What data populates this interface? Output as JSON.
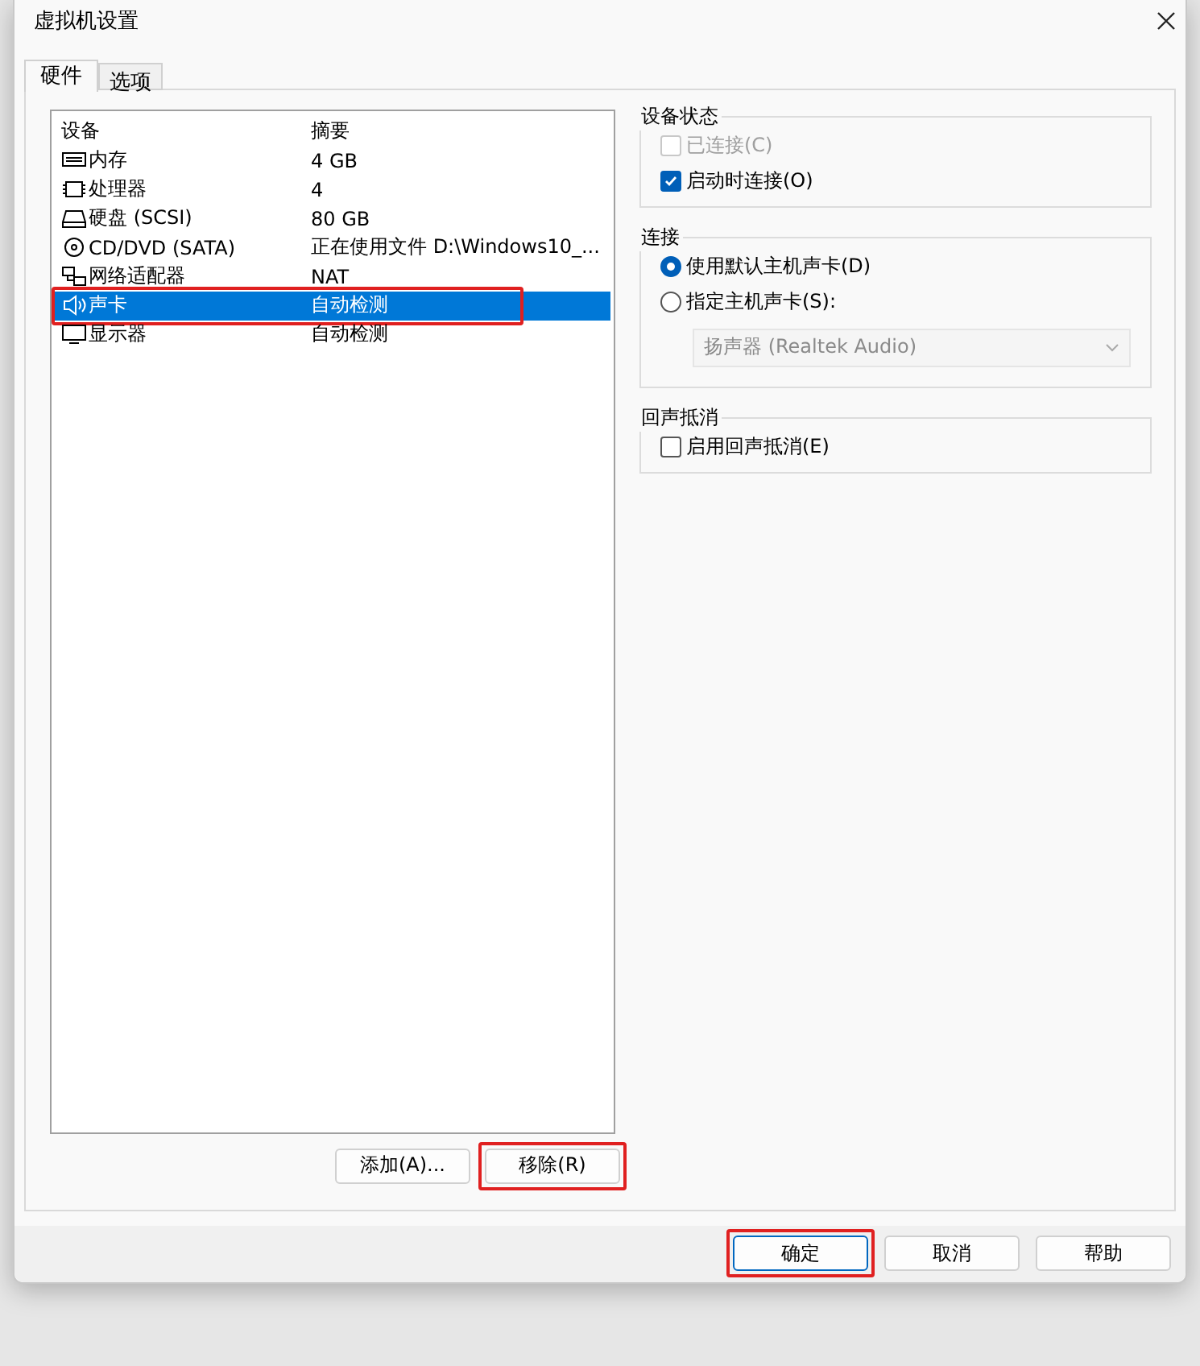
{
  "window": {
    "title": "虚拟机设置"
  },
  "tabs": [
    {
      "label": "硬件",
      "selected": true
    },
    {
      "label": "选项",
      "selected": false
    }
  ],
  "device_list": {
    "columns": [
      "设备",
      "摘要"
    ],
    "rows": [
      {
        "kind": "memory",
        "device": "内存",
        "summary": "4 GB",
        "selected": false,
        "highlighted": false
      },
      {
        "kind": "cpu",
        "device": "处理器",
        "summary": "4",
        "selected": false,
        "highlighted": false
      },
      {
        "kind": "disk",
        "device": "硬盘 (SCSI)",
        "summary": "80 GB",
        "selected": false,
        "highlighted": false
      },
      {
        "kind": "cdrom",
        "device": "CD/DVD (SATA)",
        "summary": "正在使用文件 D:\\Windows10_...",
        "selected": false,
        "highlighted": false
      },
      {
        "kind": "network",
        "device": "网络适配器",
        "summary": "NAT",
        "selected": false,
        "highlighted": false
      },
      {
        "kind": "sound",
        "device": "声卡",
        "summary": "自动检测",
        "selected": true,
        "highlighted": true
      },
      {
        "kind": "display",
        "device": "显示器",
        "summary": "自动检测",
        "selected": false,
        "highlighted": false
      }
    ]
  },
  "list_buttons": [
    {
      "label": "添加(A)...",
      "highlighted": false
    },
    {
      "label": "移除(R)",
      "highlighted": true
    }
  ],
  "groups": [
    {
      "title": "设备状态",
      "items": [
        {
          "kind": "checkbox",
          "label": "已连接(C)",
          "checked": false,
          "disabled": true
        },
        {
          "kind": "checkbox",
          "label": "启动时连接(O)",
          "checked": true,
          "disabled": false
        }
      ]
    },
    {
      "title": "连接",
      "items": [
        {
          "kind": "radio",
          "label": "使用默认主机声卡(D)",
          "selected": true,
          "disabled": false
        },
        {
          "kind": "radio",
          "label": "指定主机声卡(S):",
          "selected": false,
          "disabled": false
        },
        {
          "kind": "dropdown",
          "value": "扬声器 (Realtek Audio)",
          "disabled": true
        }
      ]
    },
    {
      "title": "回声抵消",
      "items": [
        {
          "kind": "checkbox",
          "label": "启用回声抵消(E)",
          "checked": false,
          "disabled": false
        }
      ]
    }
  ],
  "dialog_buttons": [
    {
      "label": "确定",
      "default": true,
      "highlighted": true
    },
    {
      "label": "取消",
      "default": false,
      "highlighted": false
    },
    {
      "label": "帮助",
      "default": false,
      "highlighted": false
    }
  ]
}
